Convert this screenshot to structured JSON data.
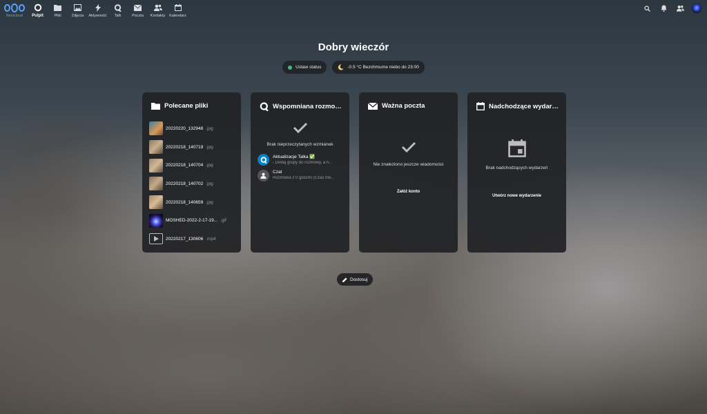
{
  "topbar": {
    "brand": "Nextcloud",
    "nav": [
      {
        "label": "Pulpit",
        "icon": "dashboard-icon",
        "active": true
      },
      {
        "label": "Pliki",
        "icon": "folder-icon"
      },
      {
        "label": "Zdjęcia",
        "icon": "image-icon"
      },
      {
        "label": "Aktywność",
        "icon": "lightning-icon"
      },
      {
        "label": "Talk",
        "icon": "talk-icon"
      },
      {
        "label": "Poczta",
        "icon": "mail-icon"
      },
      {
        "label": "Kontakty",
        "icon": "contacts-icon"
      },
      {
        "label": "Kalendarz",
        "icon": "calendar-icon"
      }
    ]
  },
  "greeting": "Dobry wieczór",
  "status": {
    "label": "Ustaw status",
    "color": "#49b382"
  },
  "weather": {
    "label": "-0.5 °C Bezchmurne niebo do 23:00"
  },
  "panels": {
    "files": {
      "title": "Polecane pliki",
      "items": [
        {
          "name": "20220220_132948",
          "ext": ".jpg"
        },
        {
          "name": "20220218_140719",
          "ext": ".jpg"
        },
        {
          "name": "20220218_140704",
          "ext": ".jpg"
        },
        {
          "name": "20220218_140702",
          "ext": ".jpg"
        },
        {
          "name": "20220218_140659",
          "ext": ".jpg"
        },
        {
          "name": "MOSHED-2022-2-17-19...",
          "ext": ".gif"
        },
        {
          "name": "20220217_130606",
          "ext": ".mp4"
        }
      ]
    },
    "talk": {
      "title": "Wspomniana rozmowa",
      "empty": "Brak nieprzeczytanych wzmianek",
      "conversations": [
        {
          "name": "Aktualizacje Talka ✅",
          "preview": "- Dodaj grupy do rozmowy, a n..."
        },
        {
          "name": "Czat",
          "preview": "Rozmowa z 0 gośćmi (Czas trw..."
        }
      ]
    },
    "mail": {
      "title": "Ważna poczta",
      "empty": "Nie znaleziono jeszcze wiadomości",
      "button": "Załóż konto"
    },
    "calendar": {
      "title": "Nadchodzące wydarzenia",
      "empty": "Brak nadchodzących wydarzeń",
      "button": "Utwórz nowe wydarzenie"
    }
  },
  "customize": "Dostosuj"
}
